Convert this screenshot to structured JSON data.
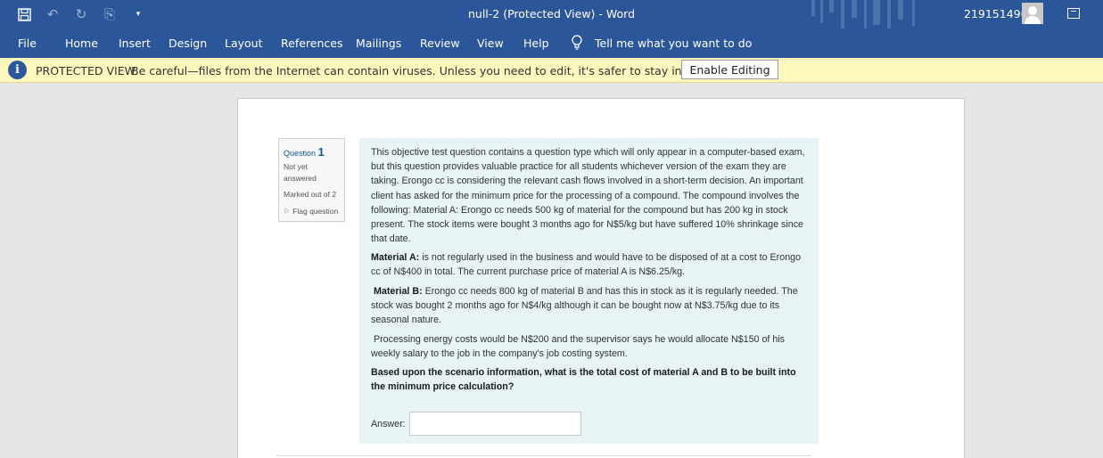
{
  "app": {
    "window_title": "null-2 (Protected View)  -  Word",
    "user_name": "219151490"
  },
  "ribbon": {
    "tabs": [
      "File",
      "Home",
      "Insert",
      "Design",
      "Layout",
      "References",
      "Mailings",
      "Review",
      "View",
      "Help"
    ],
    "tell_me": "Tell me what you want to do"
  },
  "protected_view": {
    "title": "PROTECTED VIEW",
    "message": "Be careful—files from the Internet can contain viruses. Unless you need to edit, it's safer to stay in Protected View.",
    "button": "Enable Editing"
  },
  "question": {
    "label": "Question",
    "number": "1",
    "status": "Not yet answered",
    "marks": "Marked out of 2",
    "flag": "Flag question",
    "intro": "This objective test question contains a question type which will only appear in a computer-based exam, but this question provides valuable practice for all students whichever version of the exam they are taking. Erongo cc is considering the relevant cash flows involved in a short-term decision. An important client has asked for the minimum price for the processing of a compound. The compound involves the following: Material A: Erongo cc needs 500 kg of material for the compound but has 200 kg in stock present. The stock items were bought 3 months ago for N$5/kg but have suffered 10% shrinkage since that date.",
    "material_a_label": "Material A:",
    "material_a_text": " is not regularly used in the business and would have to be disposed of at a cost to Erongo cc of N$400 in total. The current purchase price of material A is N$6.25/kg.",
    "material_b_label": "Material B:",
    "material_b_text": " Erongo cc needs 800 kg of material B and has this in stock as it is regularly needed. The stock was bought 2 months ago for N$4/kg although it can be bought now at N$3.75/kg due to its seasonal nature.",
    "processing_text": "Processing energy costs would be N$200 and the supervisor says he would allocate N$150 of his weekly salary to the job in the company's job costing system.",
    "prompt": "Based upon the scenario information, what is the total cost of material A and B to be built into the minimum price calculation?",
    "answer_label": "Answer:",
    "answer_value": ""
  },
  "colors": {
    "ribbon": "#2b579a",
    "protected_bar": "#fdf6bd",
    "question_box": "#e7f3f5"
  }
}
